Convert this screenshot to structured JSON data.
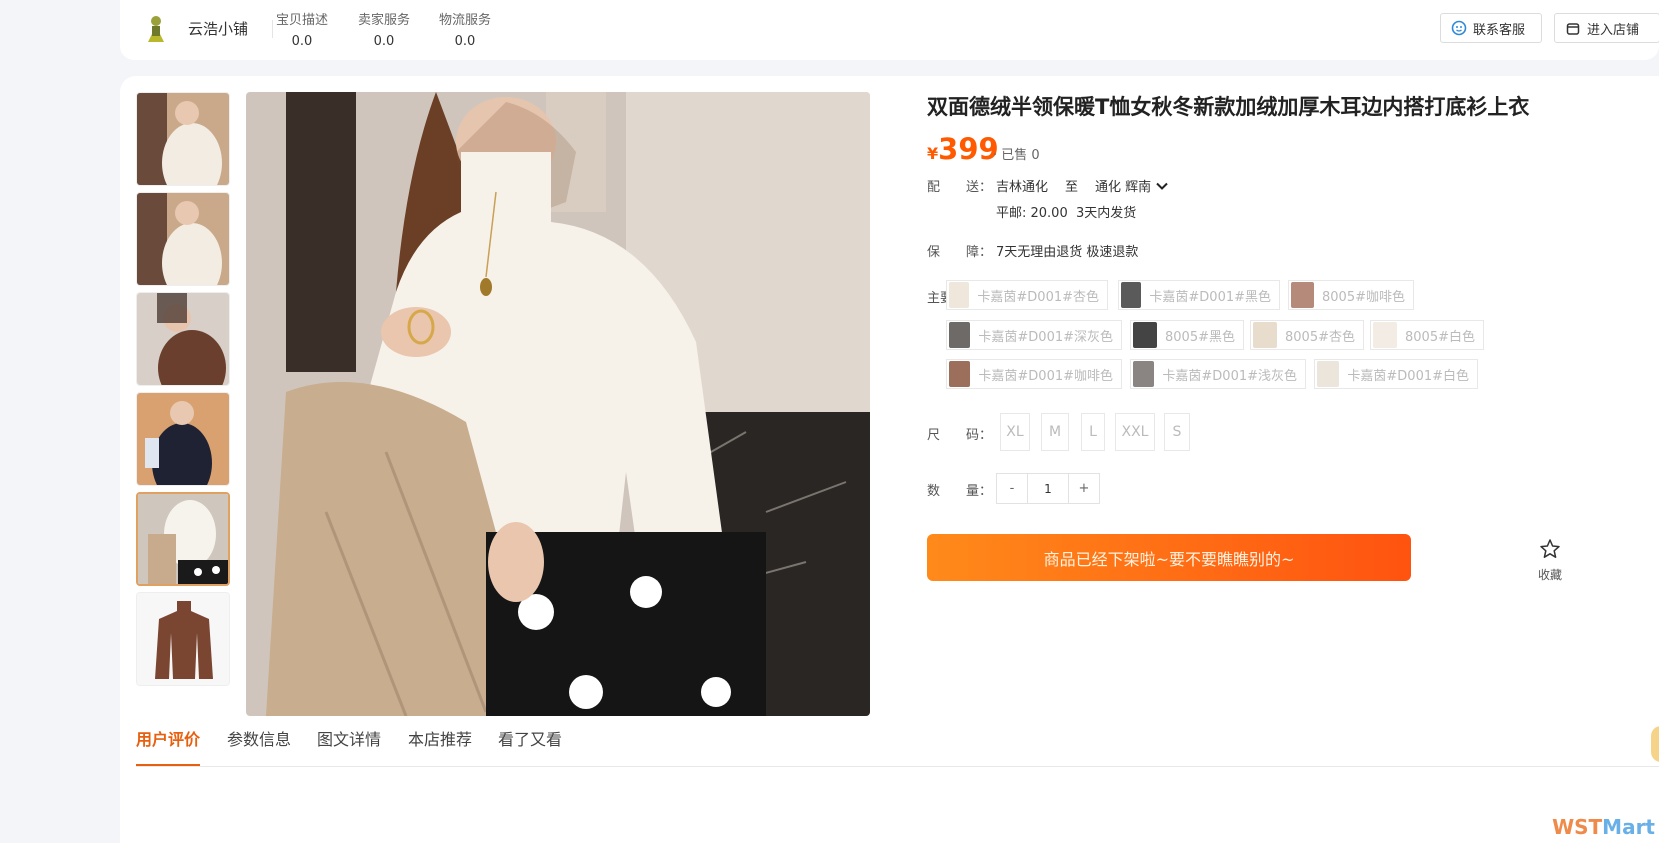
{
  "shop": {
    "name": "云浩小铺",
    "scores": [
      {
        "label": "宝贝描述",
        "value": "0.0"
      },
      {
        "label": "卖家服务",
        "value": "0.0"
      },
      {
        "label": "物流服务",
        "value": "0.0"
      }
    ],
    "contact_label": "联系客服",
    "enter_label": "进入店铺"
  },
  "product": {
    "title": "双面德绒半领保暖T恤女秋冬新款加绒加厚木耳边内搭打底衫上衣",
    "currency": "¥",
    "price": "399",
    "sold": "· 已售 0",
    "delivery": {
      "label": "配　　送：",
      "from": "吉林通化",
      "to_word": "至",
      "to": "通化 辉南",
      "shipping": "平邮: 20.00",
      "ship_time": "3天内发货"
    },
    "guarantee": {
      "label": "保　　障：",
      "text": "7天无理由退货 极速退款"
    },
    "colors_label": "主要颜色：",
    "colors": [
      {
        "name": "卡嘉茵#D001#杏色",
        "swatch": "#efe7dc"
      },
      {
        "name": "卡嘉茵#D001#黑色",
        "swatch": "#5a5a5a"
      },
      {
        "name": "8005#咖啡色",
        "swatch": "#b58a7a"
      },
      {
        "name": "卡嘉茵#D001#深灰色",
        "swatch": "#6e6a68"
      },
      {
        "name": "8005#黑色",
        "swatch": "#444"
      },
      {
        "name": "8005#杏色",
        "swatch": "#e8dccc"
      },
      {
        "name": "8005#白色",
        "swatch": "#f2ece4"
      },
      {
        "name": "卡嘉茵#D001#咖啡色",
        "swatch": "#9c6e5c"
      },
      {
        "name": "卡嘉茵#D001#浅灰色",
        "swatch": "#8a8582"
      },
      {
        "name": "卡嘉茵#D001#白色",
        "swatch": "#ebe5dc"
      }
    ],
    "size_label": "尺　　码：",
    "sizes": [
      "XL",
      "M",
      "L",
      "XXL",
      "S"
    ],
    "qty_label": "数　　量：",
    "qty": {
      "minus": "-",
      "value": "1",
      "plus": "+"
    },
    "off_shelf": "商品已经下架啦~要不要瞧瞧别的~",
    "favorite_label": "收藏"
  },
  "tabs": [
    "用户评价",
    "参数信息",
    "图文详情",
    "本店推荐",
    "看了又看"
  ],
  "watermark": {
    "part1": "WST",
    "part2": "Mart"
  },
  "colors": {
    "accent": "#e6600f",
    "price": "#ff5a00",
    "button": "#ff6a14"
  }
}
